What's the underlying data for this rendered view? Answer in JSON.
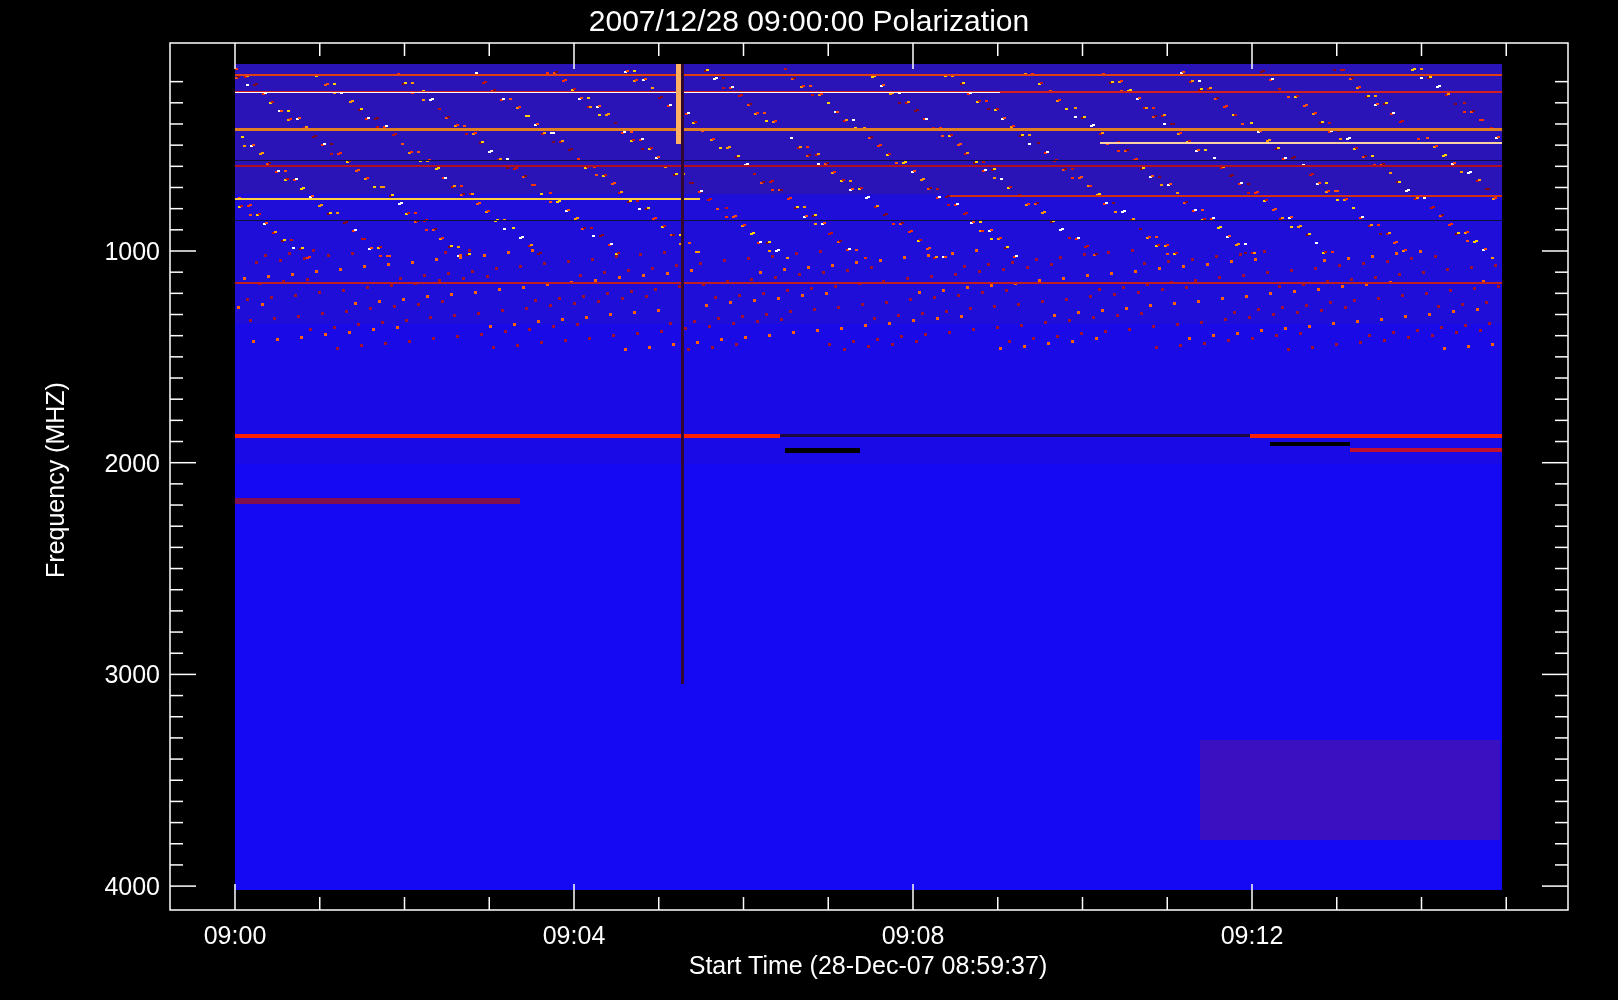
{
  "title": "2007/12/28 09:00:00 Polarization",
  "y_axis": {
    "label": "Frequency (MHZ)",
    "tick_labels": [
      "1000",
      "2000",
      "3000",
      "4000"
    ]
  },
  "x_axis": {
    "label": "Start Time (28-Dec-07 08:59:37)",
    "tick_labels": [
      "09:00",
      "09:04",
      "09:08",
      "09:12"
    ]
  }
}
